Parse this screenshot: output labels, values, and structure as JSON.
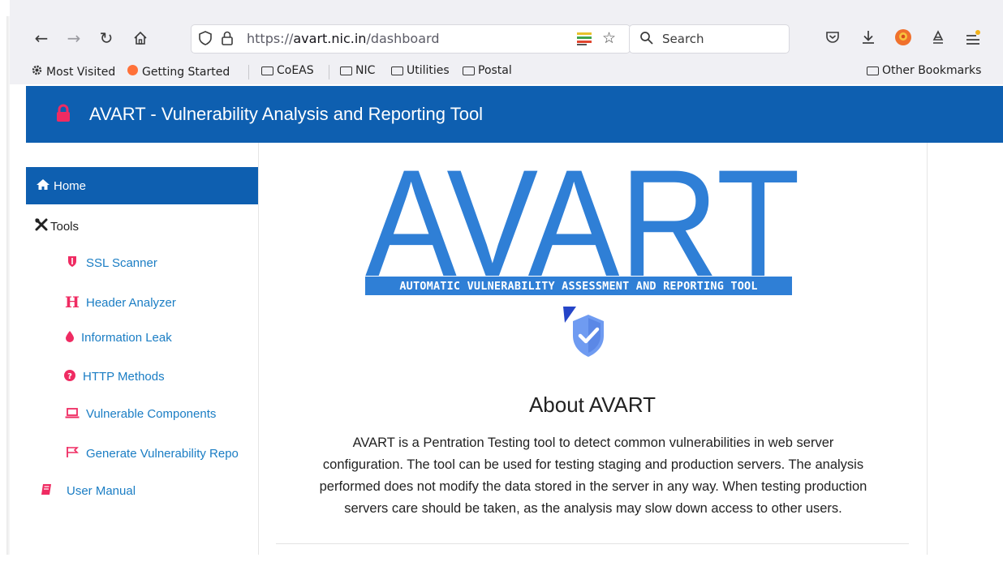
{
  "browser": {
    "url_prefix": "https://",
    "url_host": "avart.nic.in",
    "url_path": "/dashboard",
    "search_placeholder": "Search",
    "bookmarks": [
      {
        "label": "Most Visited",
        "icon": "gear-icon"
      },
      {
        "label": "Getting Started",
        "icon": "firefox-icon"
      },
      {
        "label": "CoEAS",
        "icon": "folder-icon"
      },
      {
        "label": "NIC",
        "icon": "folder-icon"
      },
      {
        "label": "Utilities",
        "icon": "folder-icon"
      },
      {
        "label": "Postal",
        "icon": "folder-icon"
      }
    ],
    "other_bookmarks": "Other Bookmarks"
  },
  "site": {
    "title": "AVART - Vulnerability Analysis and Reporting Tool",
    "header_color": "#0e5fb0",
    "accent_color": "#ef2b62"
  },
  "sidebar": {
    "home": "Home",
    "tools": "Tools",
    "items": [
      {
        "label": "SSL Scanner",
        "icon": "shield-icon"
      },
      {
        "label": "Header Analyzer",
        "icon": "h-letter-icon"
      },
      {
        "label": "Information Leak",
        "icon": "droplet-icon"
      },
      {
        "label": "HTTP Methods",
        "icon": "question-circle-icon"
      },
      {
        "label": "Vulnerable Components",
        "icon": "laptop-icon"
      },
      {
        "label": "Generate Vulnerability Repo",
        "icon": "flag-icon"
      }
    ],
    "manual": "User Manual"
  },
  "main": {
    "logo_text": "AVART",
    "logo_tagline": "AUTOMATIC VULNERABILITY ASSESSMENT AND REPORTING TOOL",
    "about_title": "About AVART",
    "about_lines": [
      "AVART is a Pentration Testing tool to detect common vulnerabilities in web server",
      "configuration. The tool can be used for testing staging and production servers. The analysis",
      "performed does not modify the data stored in the server in any way. When testing production",
      "servers care should be taken, as the analysis may slow down access to other users."
    ]
  }
}
